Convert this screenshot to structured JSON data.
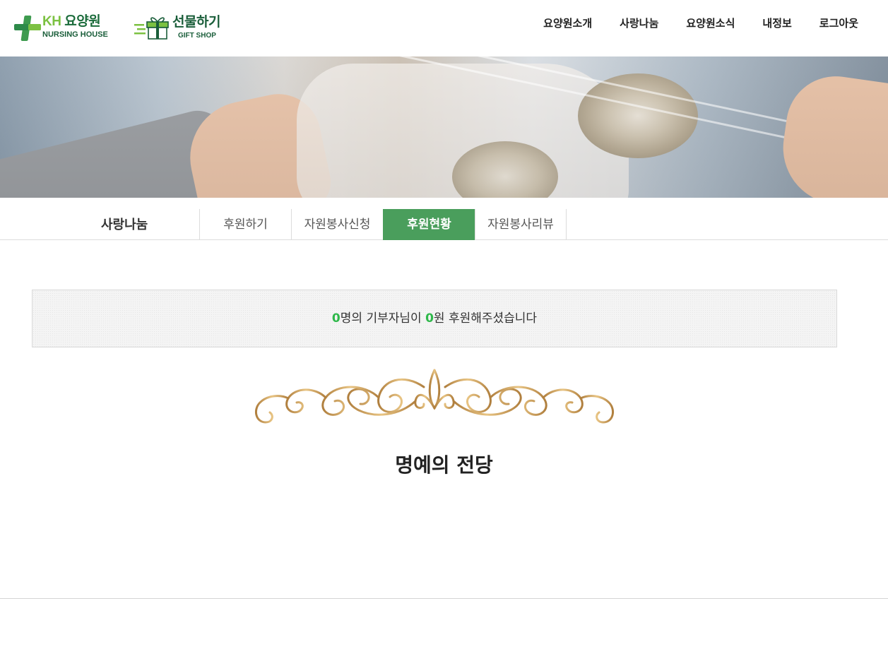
{
  "header": {
    "logo_kh": {
      "brand_prefix": "KH",
      "brand_name": "요양원",
      "sub": "NURSING HOUSE"
    },
    "logo_gift": {
      "name": "선물하기",
      "sub": "GIFT SHOP"
    },
    "nav": [
      {
        "label": "요양원소개"
      },
      {
        "label": "사랑나눔"
      },
      {
        "label": "요양원소식"
      },
      {
        "label": "내정보"
      },
      {
        "label": "로그아웃"
      }
    ]
  },
  "subnav": {
    "title": "사랑나눔",
    "tabs": [
      {
        "label": "후원하기",
        "active": false
      },
      {
        "label": "자원봉사신청",
        "active": false
      },
      {
        "label": "후원현황",
        "active": true
      },
      {
        "label": "자원봉사리뷰",
        "active": false
      }
    ]
  },
  "summary": {
    "donor_count": "0",
    "donor_text": "명의 기부자님이 ",
    "amount": "0",
    "amount_text": "원 후원해주셨습니다"
  },
  "hall_of_fame": {
    "title": "명예의 전당"
  },
  "colors": {
    "accent_green": "#4a9e5c",
    "number_green": "#2eb84a",
    "ornament_gold": "#c9a35a"
  }
}
